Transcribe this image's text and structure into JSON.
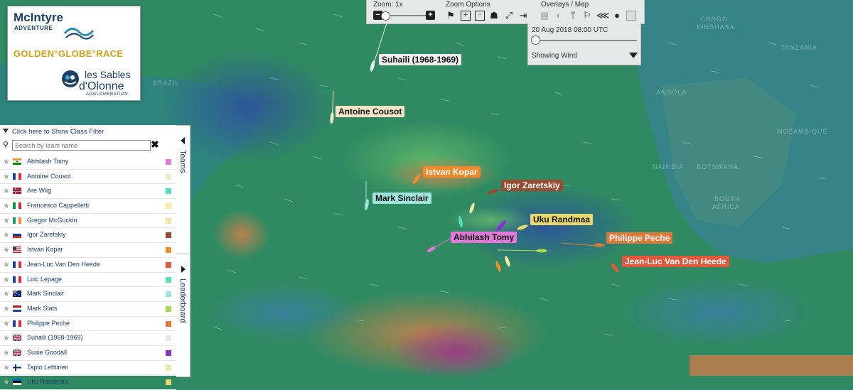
{
  "logo": {
    "line1": "McIntyre",
    "line2": "ADVENTURE",
    "race": "GOLDEN°GLOBE°RACE",
    "sponsor1": "les Sables",
    "sponsor2": "d'Olonne",
    "sponsor3": "AGGLOMERATION"
  },
  "toolbar": {
    "zoom_title": "Zoom: 1x",
    "zoom_out": "−",
    "zoom_in": "+",
    "zoom_options_title": "Zoom Options",
    "overlays_title": "Overlays / Map"
  },
  "time_panel": {
    "date": "20 Aug 2018 08:00 UTC",
    "overlay": "Showing Wind"
  },
  "map_labels": {
    "brazil": "BRAZIL",
    "congo": "CONGO",
    "kinshasa": "KINSHASA",
    "tanzania": "TANZANIA",
    "angola": "ANGOLA",
    "mozambique": "MOZAMBIQUE",
    "namibia": "NAMIBIA",
    "botswana": "BOTSWANA",
    "south": "SOUTH",
    "africa": "AFRICA"
  },
  "sidebar": {
    "class_filter": "Click here to Show Class Filter",
    "search_placeholder": "Search by team name",
    "clear": "✖",
    "teams_tab": "Teams",
    "leaderboard_tab": "Leaderboard",
    "teams": [
      {
        "name": "Abhilash Tomy",
        "color": "#e07ad8"
      },
      {
        "name": "Antoine Cousot",
        "color": "#f5e8c8"
      },
      {
        "name": "Are Wiig",
        "color": "#4fe0c8"
      },
      {
        "name": "Francesco Cappelletti",
        "color": "#f7efa0"
      },
      {
        "name": "Gregor McGuckin",
        "color": "#f3e3a8"
      },
      {
        "name": "Igor Zaretskiy",
        "color": "#9b4a32"
      },
      {
        "name": "Istvan Kopar",
        "color": "#f08a2a"
      },
      {
        "name": "Jean-Luc Van Den Heede",
        "color": "#e4573a"
      },
      {
        "name": "Loic Lepage",
        "color": "#53e0b8"
      },
      {
        "name": "Mark Sinclair",
        "color": "#9fe3df"
      },
      {
        "name": "Mark Slats",
        "color": "#a6d94a"
      },
      {
        "name": "Philippe Peche",
        "color": "#e0783a"
      },
      {
        "name": "Suhaili (1968-1969)",
        "color": "#e6e6e6"
      },
      {
        "name": "Susie Goodall",
        "color": "#8a2fd0"
      },
      {
        "name": "Tapio Lehtinen",
        "color": "#f0e8a0"
      },
      {
        "name": "Uku Randmaa",
        "color": "#e9d96a"
      }
    ]
  },
  "boats": {
    "suhaili": "Suhaili (1968-1969)",
    "cousot": "Antoine Cousot",
    "kopar": "Istvan Kopar",
    "zaretskiy": "Igor Zaretskiy",
    "sinclair": "Mark Sinclair",
    "randmaa": "Uku Randmaa",
    "tomy": "Abhilash Tomy",
    "peche": "Philippe Peche",
    "vdh": "Jean-Luc Van Den Heede"
  }
}
